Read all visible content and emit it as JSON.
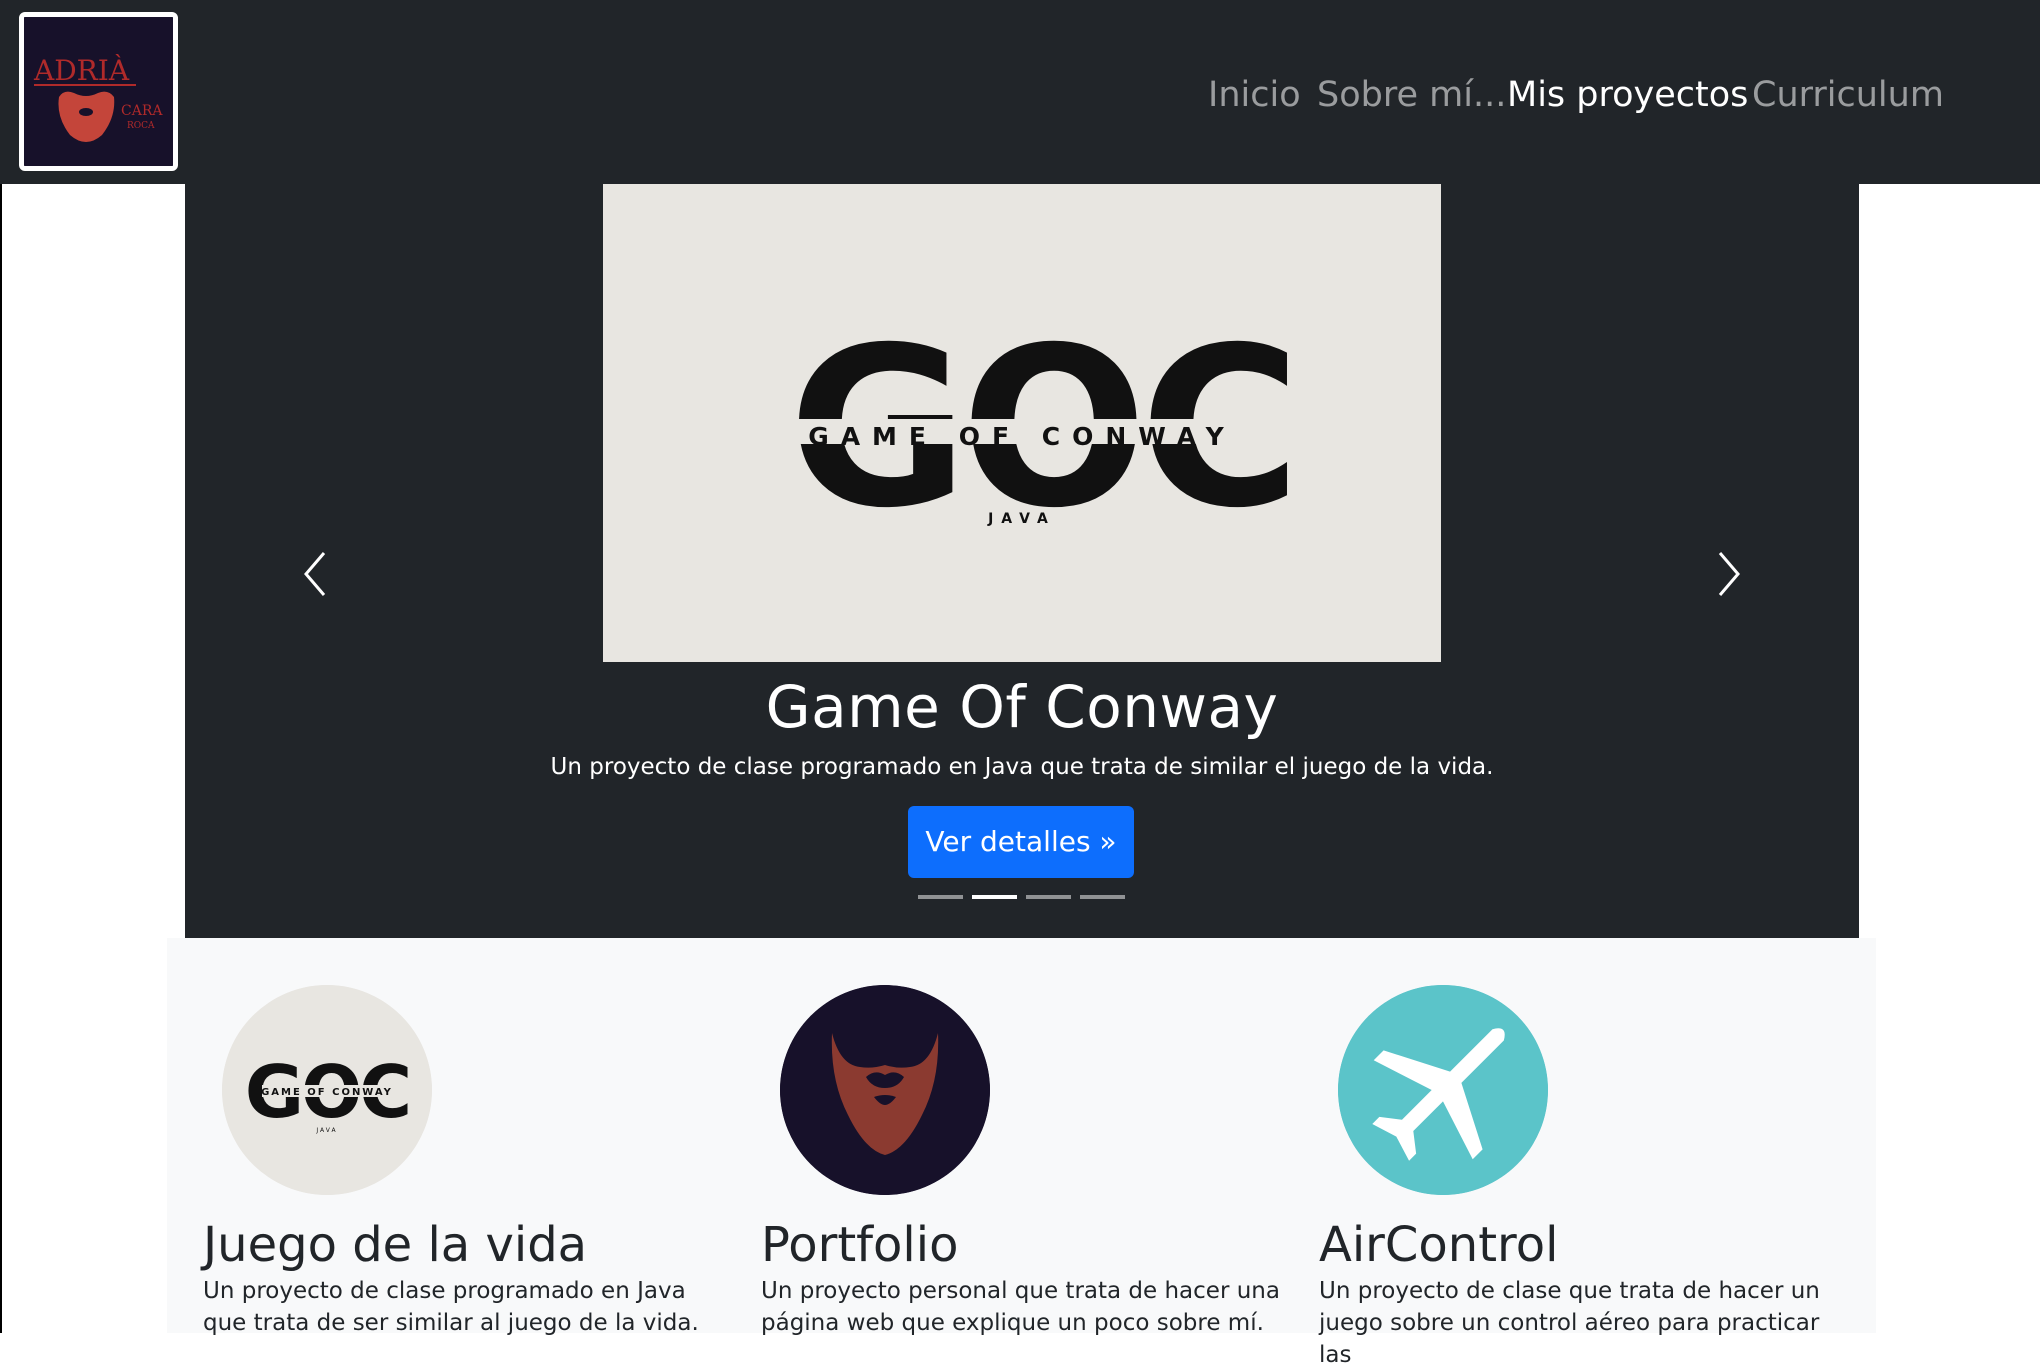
{
  "logo": {
    "text_main": "ADRIÀ",
    "text_sub": "CARA",
    "text_sub2": "ROCA",
    "bg": "#17112a",
    "accent": "#b02a2a"
  },
  "nav": {
    "items": [
      {
        "label": "Inicio",
        "active": false
      },
      {
        "label": "Sobre mí...",
        "active": false
      },
      {
        "label": "Mis proyectos",
        "active": true
      },
      {
        "label": "Curriculum",
        "active": false
      }
    ]
  },
  "carousel": {
    "image_text": {
      "big": "GOC",
      "middle": "GAME OF CONWAY",
      "small": "JAVA"
    },
    "title": "Game Of Conway",
    "text": "Un proyecto de clase programado en Java que trata de similar el juego de la vida.",
    "button_label": "Ver detalles »",
    "prev_icon": "chevron-left-icon",
    "next_icon": "chevron-right-icon",
    "indicator_count": 4,
    "active_index": 1
  },
  "features": [
    {
      "title": "Juego de la vida",
      "text": "Un proyecto de clase programado en Java que trata de ser similar al juego de la vida.",
      "icon": "goc-logo-icon",
      "circle_color": "#e8e6e1"
    },
    {
      "title": "Portfolio",
      "text": "Un proyecto personal que trata de hacer una página web que explique un poco sobre mí.",
      "icon": "beard-icon",
      "circle_color": "#17112a"
    },
    {
      "title": "AirControl",
      "text": "Un proyecto de clase que trata de hacer un juego sobre un control aéreo para practicar las",
      "icon": "airplane-icon",
      "circle_color": "#5bc4c9"
    }
  ],
  "colors": {
    "navbar": "#212529",
    "primary": "#0d6efd",
    "light_bg": "#f8f9fa"
  }
}
